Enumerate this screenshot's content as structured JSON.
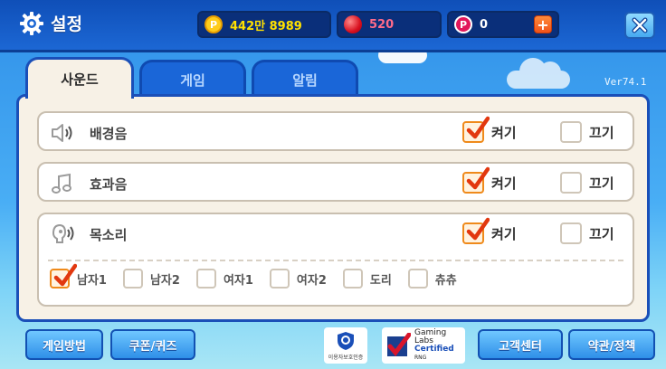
{
  "header": {
    "title": "설정",
    "gold": "442만 8989",
    "ruby": "520",
    "points": "0",
    "coin_symbol": "P",
    "plus_symbol": "+"
  },
  "tabs": [
    {
      "label": "사운드",
      "active": true
    },
    {
      "label": "게임",
      "active": false
    },
    {
      "label": "알림",
      "active": false
    }
  ],
  "version": "Ver74.1",
  "settings": {
    "on_label": "켜기",
    "off_label": "끄기",
    "rows": [
      {
        "label": "배경음",
        "icon": "speaker-icon",
        "on": true
      },
      {
        "label": "효과음",
        "icon": "music-note-icon",
        "on": true
      },
      {
        "label": "목소리",
        "icon": "voice-icon",
        "on": true
      }
    ],
    "voices": [
      {
        "label": "남자1",
        "selected": true
      },
      {
        "label": "남자2",
        "selected": false
      },
      {
        "label": "여자1",
        "selected": false
      },
      {
        "label": "여자2",
        "selected": false
      },
      {
        "label": "도리",
        "selected": false
      },
      {
        "label": "츄츄",
        "selected": false
      }
    ]
  },
  "footer": {
    "howto": "게임방법",
    "coupon": "쿠폰/퀴즈",
    "support": "고객센터",
    "policy": "약관/정책",
    "protection_badge": "이용자보호인증",
    "gli_line1": "Gaming",
    "gli_line2": "Labs",
    "gli_line3": "Certified",
    "gli_line4": "RNG"
  },
  "colors": {
    "brand_blue": "#1a4fb8",
    "check_orange": "#ef8a1b",
    "gold_text": "#ffe100",
    "ruby_text": "#ff6b8a"
  }
}
